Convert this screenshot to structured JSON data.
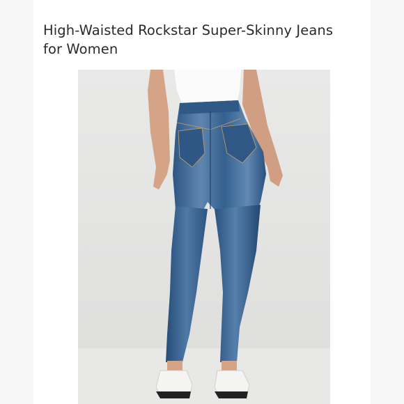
{
  "product": {
    "title": "High-Waisted Rockstar Super-Skinny Jeans for Women"
  },
  "image": {
    "subject": "jeans-back-view-icon",
    "colors": {
      "background": "#e5e5e4",
      "denim": "#2f5a88",
      "denim_light": "#5a82ad",
      "top": "#fafafa",
      "shoes": "#f4f4f2",
      "skin": "#d6a58a"
    }
  }
}
